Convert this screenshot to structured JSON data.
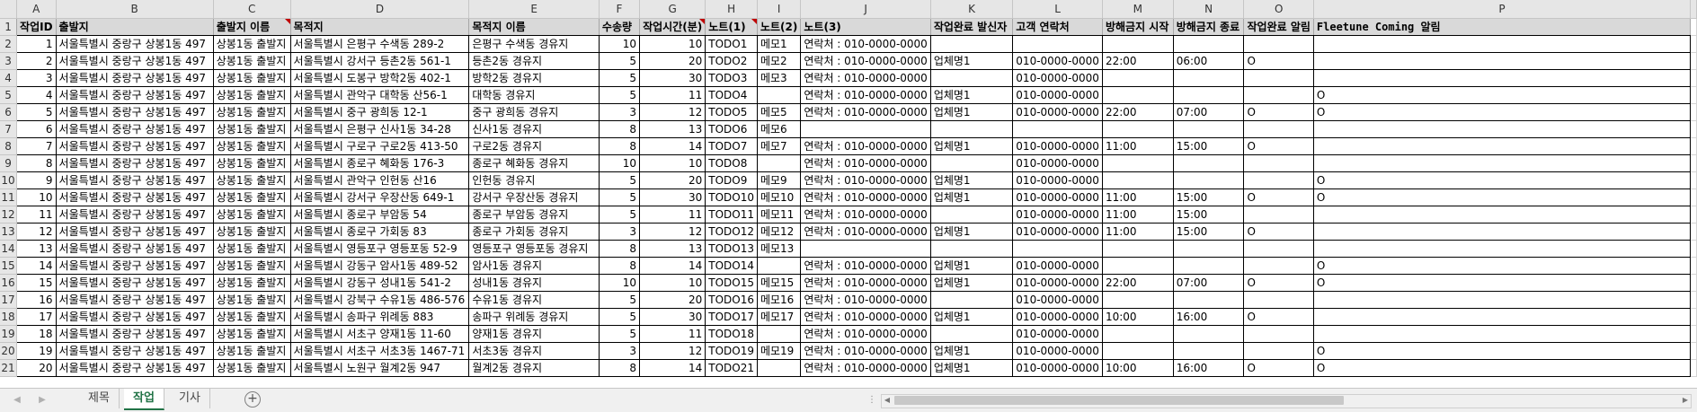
{
  "column_letters": [
    "A",
    "B",
    "C",
    "D",
    "E",
    "F",
    "G",
    "H",
    "I",
    "J",
    "K",
    "L",
    "M",
    "N",
    "O",
    "P"
  ],
  "headers": [
    "작업ID",
    "출발지",
    "출발지 이름",
    "목적지",
    "목적지 이름",
    "수송량",
    "작업시간(분)",
    "노트(1)",
    "노트(2)",
    "노트(3)",
    "작업완료 발신자",
    "고객 연락처",
    "방해금지 시작",
    "방해금지 종료",
    "작업완료 알림",
    "Fleetune Coming 알림"
  ],
  "rows": [
    [
      "1",
      "서울특별시 중랑구 상봉1동 497",
      "상봉1동 출발지",
      "서울특별시 은평구 수색동 289-2",
      "은평구 수색동 경유지",
      "10",
      "10",
      "TODO1",
      "메모1",
      "연락처 : 010-0000-0000",
      "",
      "",
      "",
      "",
      "",
      ""
    ],
    [
      "2",
      "서울특별시 중랑구 상봉1동 497",
      "상봉1동 출발지",
      "서울특별시 강서구 등촌2동 561-1",
      "등촌2동 경유지",
      "5",
      "20",
      "TODO2",
      "메모2",
      "연락처 : 010-0000-0000",
      "업체명1",
      "010-0000-0000",
      "22:00",
      "06:00",
      "O",
      ""
    ],
    [
      "3",
      "서울특별시 중랑구 상봉1동 497",
      "상봉1동 출발지",
      "서울특별시 도봉구 방학2동 402-1",
      "방학2동 경유지",
      "5",
      "30",
      "TODO3",
      "메모3",
      "연락처 : 010-0000-0000",
      "",
      "010-0000-0000",
      "",
      "",
      "",
      ""
    ],
    [
      "4",
      "서울특별시 중랑구 상봉1동 497",
      "상봉1동 출발지",
      "서울특별시 관악구 대학동 산56-1",
      "대학동 경유지",
      "5",
      "11",
      "TODO4",
      "",
      "연락처 : 010-0000-0000",
      "업체명1",
      "010-0000-0000",
      "",
      "",
      "",
      "O"
    ],
    [
      "5",
      "서울특별시 중랑구 상봉1동 497",
      "상봉1동 출발지",
      "서울특별시 중구 광희동 12-1",
      "중구 광희동 경유지",
      "3",
      "12",
      "TODO5",
      "메모5",
      "연락처 : 010-0000-0000",
      "업체명1",
      "010-0000-0000",
      "22:00",
      "07:00",
      "O",
      "O"
    ],
    [
      "6",
      "서울특별시 중랑구 상봉1동 497",
      "상봉1동 출발지",
      "서울특별시 은평구 신사1동 34-28",
      "신사1동 경유지",
      "8",
      "13",
      "TODO6",
      "메모6",
      "",
      "",
      "",
      "",
      "",
      "",
      ""
    ],
    [
      "7",
      "서울특별시 중랑구 상봉1동 497",
      "상봉1동 출발지",
      "서울특별시 구로구 구로2동 413-50",
      "구로2동 경유지",
      "8",
      "14",
      "TODO7",
      "메모7",
      "연락처 : 010-0000-0000",
      "업체명1",
      "010-0000-0000",
      "11:00",
      "15:00",
      "O",
      ""
    ],
    [
      "8",
      "서울특별시 중랑구 상봉1동 497",
      "상봉1동 출발지",
      "서울특별시 종로구 혜화동 176-3",
      "종로구 혜화동 경유지",
      "10",
      "10",
      "TODO8",
      "",
      "연락처 : 010-0000-0000",
      "",
      "010-0000-0000",
      "",
      "",
      "",
      ""
    ],
    [
      "9",
      "서울특별시 중랑구 상봉1동 497",
      "상봉1동 출발지",
      "서울특별시 관악구 인헌동 산16",
      "인헌동 경유지",
      "5",
      "20",
      "TODO9",
      "메모9",
      "연락처 : 010-0000-0000",
      "업체명1",
      "010-0000-0000",
      "",
      "",
      "",
      "O"
    ],
    [
      "10",
      "서울특별시 중랑구 상봉1동 497",
      "상봉1동 출발지",
      "서울특별시 강서구 우장산동 649-1",
      "강서구 우장산동 경유지",
      "5",
      "30",
      "TODO10",
      "메모10",
      "연락처 : 010-0000-0000",
      "업체명1",
      "010-0000-0000",
      "11:00",
      "15:00",
      "O",
      "O"
    ],
    [
      "11",
      "서울특별시 중랑구 상봉1동 497",
      "상봉1동 출발지",
      "서울특별시 종로구 부암동 54",
      "종로구 부암동 경유지",
      "5",
      "11",
      "TODO11",
      "메모11",
      "연락처 : 010-0000-0000",
      "",
      "010-0000-0000",
      "11:00",
      "15:00",
      "",
      ""
    ],
    [
      "12",
      "서울특별시 중랑구 상봉1동 497",
      "상봉1동 출발지",
      "서울특별시 종로구 가회동 83",
      "종로구 가회동 경유지",
      "3",
      "12",
      "TODO12",
      "메모12",
      "연락처 : 010-0000-0000",
      "업체명1",
      "010-0000-0000",
      "11:00",
      "15:00",
      "O",
      ""
    ],
    [
      "13",
      "서울특별시 중랑구 상봉1동 497",
      "상봉1동 출발지",
      "서울특별시 영등포구 영등포동 52-9",
      "영등포구 영등포동 경유지",
      "8",
      "13",
      "TODO13",
      "메모13",
      "",
      "",
      "",
      "",
      "",
      "",
      ""
    ],
    [
      "14",
      "서울특별시 중랑구 상봉1동 497",
      "상봉1동 출발지",
      "서울특별시 강동구 암사1동 489-52",
      "암사1동 경유지",
      "8",
      "14",
      "TODO14",
      "",
      "연락처 : 010-0000-0000",
      "업체명1",
      "010-0000-0000",
      "",
      "",
      "",
      "O"
    ],
    [
      "15",
      "서울특별시 중랑구 상봉1동 497",
      "상봉1동 출발지",
      "서울특별시 강동구 성내1동 541-2",
      "성내1동 경유지",
      "10",
      "10",
      "TODO15",
      "메모15",
      "연락처 : 010-0000-0000",
      "업체명1",
      "010-0000-0000",
      "22:00",
      "07:00",
      "O",
      "O"
    ],
    [
      "16",
      "서울특별시 중랑구 상봉1동 497",
      "상봉1동 출발지",
      "서울특별시 강북구 수유1동 486-576",
      "수유1동 경유지",
      "5",
      "20",
      "TODO16",
      "메모16",
      "연락처 : 010-0000-0000",
      "",
      "010-0000-0000",
      "",
      "",
      "",
      ""
    ],
    [
      "17",
      "서울특별시 중랑구 상봉1동 497",
      "상봉1동 출발지",
      "서울특별시 송파구 위례동 883",
      "송파구 위례동 경유지",
      "5",
      "30",
      "TODO17",
      "메모17",
      "연락처 : 010-0000-0000",
      "업체명1",
      "010-0000-0000",
      "10:00",
      "16:00",
      "O",
      ""
    ],
    [
      "18",
      "서울특별시 중랑구 상봉1동 497",
      "상봉1동 출발지",
      "서울특별시 서초구 양재1동 11-60",
      "양재1동 경유지",
      "5",
      "11",
      "TODO18",
      "",
      "연락처 : 010-0000-0000",
      "",
      "010-0000-0000",
      "",
      "",
      "",
      ""
    ],
    [
      "19",
      "서울특별시 중랑구 상봉1동 497",
      "상봉1동 출발지",
      "서울특별시 서초구 서초3동 1467-71",
      "서초3동 경유지",
      "3",
      "12",
      "TODO19",
      "메모19",
      "연락처 : 010-0000-0000",
      "업체명1",
      "010-0000-0000",
      "",
      "",
      "",
      "O"
    ],
    [
      "20",
      "서울특별시 중랑구 상봉1동 497",
      "상봉1동 출발지",
      "서울특별시 노원구 월계2동 947",
      "월계2동 경유지",
      "8",
      "14",
      "TODO21",
      "",
      "연락처 : 010-0000-0000",
      "업체명1",
      "010-0000-0000",
      "10:00",
      "16:00",
      "O",
      "O"
    ]
  ],
  "sheet_tabs": [
    "제목",
    "작업",
    "기사"
  ],
  "active_tab": "작업",
  "add_sheet_label": "+",
  "colors": {
    "header_fill": "#d9d9d9",
    "active_tab": "#217346",
    "comment_marker": "#c00000"
  }
}
